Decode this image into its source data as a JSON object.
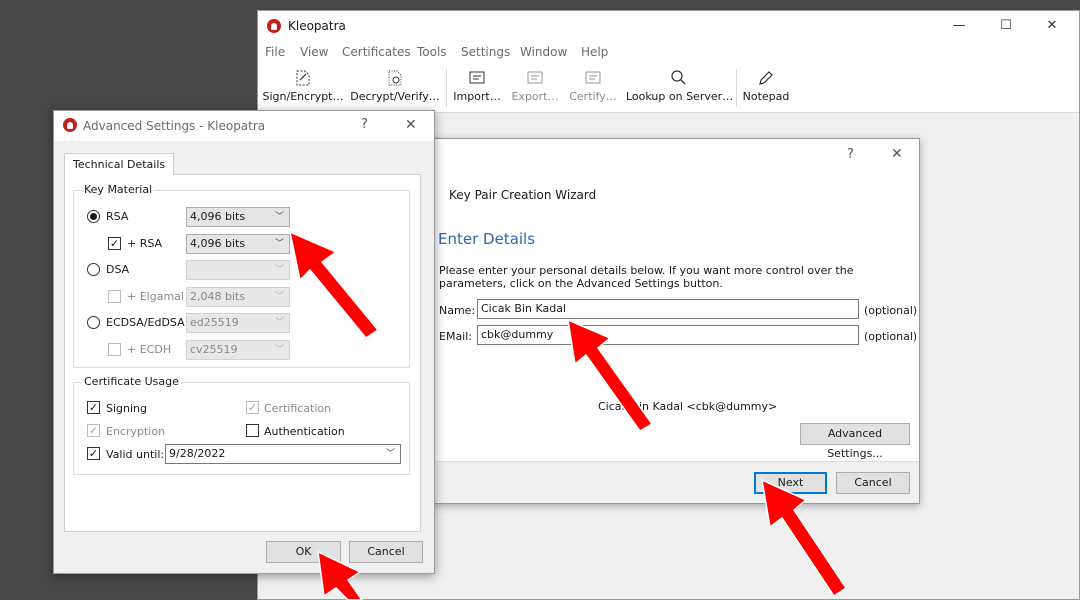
{
  "main_window": {
    "title": "Kleopatra",
    "caption": {
      "minimize": "—",
      "maximize": "☐",
      "close": "✕"
    },
    "menu": [
      "File",
      "View",
      "Certificates",
      "Tools",
      "Settings",
      "Window",
      "Help"
    ],
    "toolbar": [
      {
        "label": "Sign/Encrypt…",
        "icon": "sign-encrypt-icon",
        "enabled": true
      },
      {
        "label": "Decrypt/Verify…",
        "icon": "decrypt-verify-icon",
        "enabled": true
      },
      {
        "label": "Import…",
        "icon": "import-icon",
        "enabled": true
      },
      {
        "label": "Export…",
        "icon": "export-icon",
        "enabled": false
      },
      {
        "label": "Certify…",
        "icon": "certify-icon",
        "enabled": false
      },
      {
        "label": "Lookup on Server…",
        "icon": "search-icon",
        "enabled": true
      },
      {
        "label": "Notepad",
        "icon": "pencil-icon",
        "enabled": true
      }
    ]
  },
  "wizard": {
    "help": "?",
    "close": "✕",
    "title": "Key Pair Creation Wizard",
    "heading": "Enter Details",
    "description": "Please enter your personal details below. If you want more control over the parameters, click on the Advanced Settings button.",
    "name_label": "Name:",
    "name_value": "Cicak Bin Kadal",
    "email_label": "EMail:",
    "email_value": "cbk@dummy",
    "optional": "(optional)",
    "preview": "Cicak Bin Kadal <cbk@dummy>",
    "advanced_button": "Advanced Settings...",
    "next_button": "Next",
    "cancel_button": "Cancel"
  },
  "advanced": {
    "title": "Advanced Settings - Kleopatra",
    "help": "?",
    "close": "✕",
    "tab": "Technical Details",
    "key_material": {
      "title": "Key Material",
      "rsa_label": "RSA",
      "rsa_bits": "4,096 bits",
      "plus_rsa_label": "+ RSA",
      "plus_rsa_bits": "4,096 bits",
      "dsa_label": "DSA",
      "dsa_bits": "",
      "elgamal_label": "+ Elgamal",
      "elgamal_bits": "2,048 bits",
      "ecdsa_label": "ECDSA/EdDSA",
      "ecdsa_curve": "ed25519",
      "ecdh_label": "+ ECDH",
      "ecdh_curve": "cv25519"
    },
    "usage": {
      "title": "Certificate Usage",
      "signing": "Signing",
      "certification": "Certification",
      "encryption": "Encryption",
      "authentication": "Authentication",
      "valid_until": "Valid until:",
      "valid_date": "9/28/2022"
    },
    "ok_button": "OK",
    "cancel_button": "Cancel"
  },
  "colors": {
    "arrow": "#ff0000",
    "heading": "#3366aa",
    "default_button_border": "#0078d7"
  }
}
